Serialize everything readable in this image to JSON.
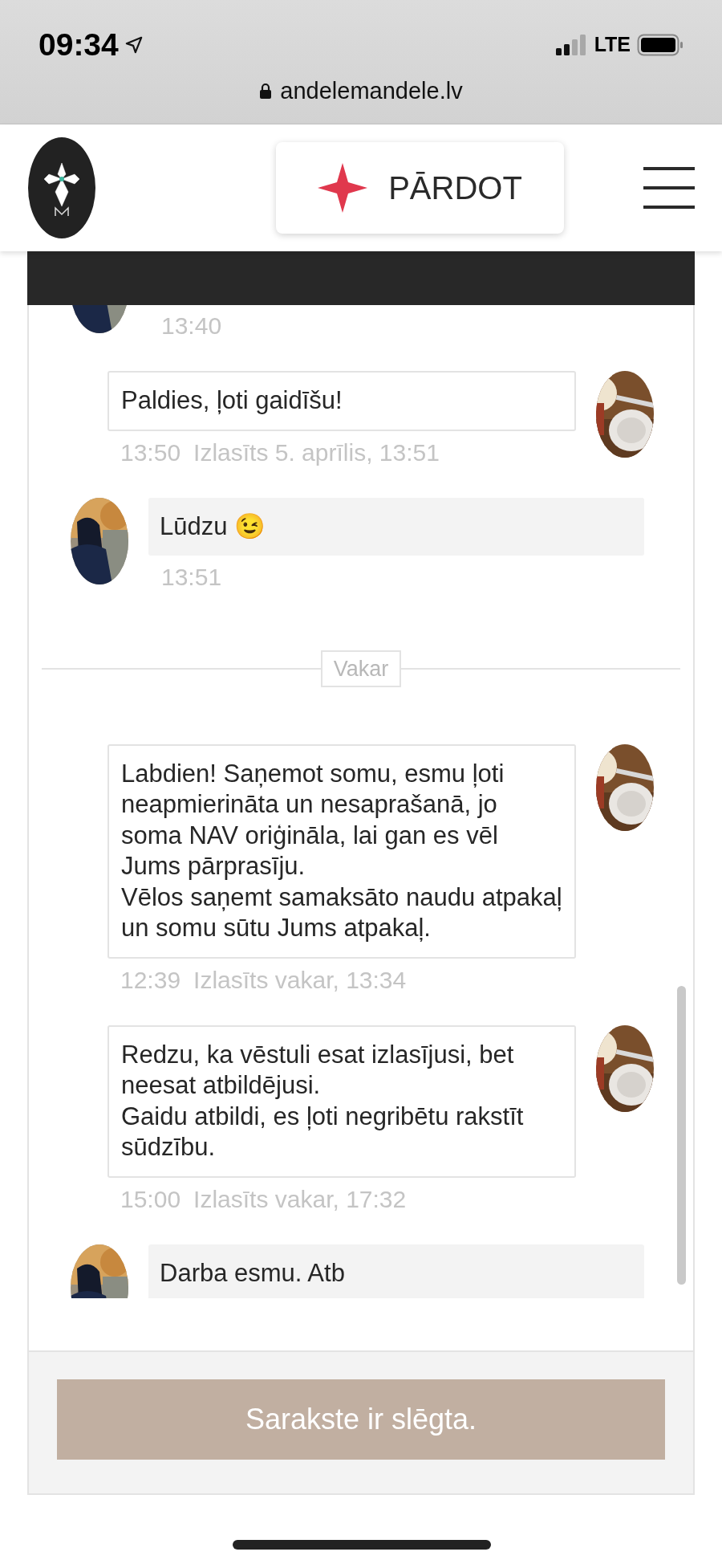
{
  "status_bar": {
    "time": "09:34",
    "network": "LTE"
  },
  "browser": {
    "url": "andelemandele.lv"
  },
  "header": {
    "sell_button": "PĀRDOT"
  },
  "thread": [
    {
      "kind": "message",
      "outgoing": false,
      "time": "13:40"
    },
    {
      "kind": "message",
      "outgoing": true,
      "text": "Paldies, ļoti gaidīšu!",
      "time": "13:50",
      "read_status": "Izlasīts 5. aprīlis, 13:51"
    },
    {
      "kind": "message",
      "outgoing": false,
      "text": "Lūdzu 😉",
      "time": "13:51"
    },
    {
      "kind": "separator",
      "label": "Vakar"
    },
    {
      "kind": "message",
      "outgoing": true,
      "text": "Labdien! Saņemot somu, esmu ļoti neapmierināta un nesaprašanā, jo soma NAV oriģināla, lai gan es vēl Jums pārprasīju.\nVēlos saņemt samaksāto naudu atpakaļ un somu sūtu Jums atpakaļ.",
      "time": "12:39",
      "read_status": "Izlasīts vakar, 13:34"
    },
    {
      "kind": "message",
      "outgoing": true,
      "text": "Redzu, ka vēstuli esat izlasījusi, bet neesat atbildējusi.\nGaidu atbildi, es ļoti negribētu rakstīt sūdzību.",
      "time": "15:00",
      "read_status": "Izlasīts vakar, 17:32"
    },
    {
      "kind": "message",
      "outgoing": false,
      "text": "Darba esmu. Atb"
    }
  ],
  "closed_notice": "Sarakste ir slēgta."
}
